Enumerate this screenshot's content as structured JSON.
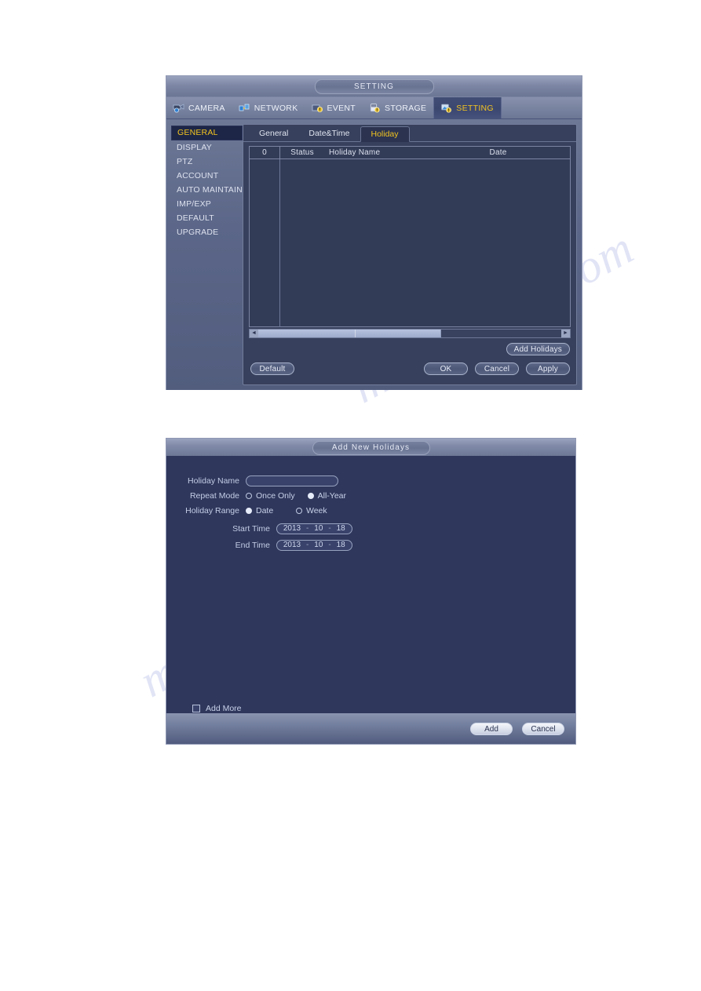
{
  "watermark": {
    "line1": "manualslib.com",
    "line2": "manualslib.com"
  },
  "setting_window": {
    "title": "SETTING",
    "menu": [
      {
        "label": "CAMERA",
        "icon": "camera-icon",
        "active": false
      },
      {
        "label": "NETWORK",
        "icon": "network-icon",
        "active": false
      },
      {
        "label": "EVENT",
        "icon": "event-icon",
        "active": false
      },
      {
        "label": "STORAGE",
        "icon": "storage-icon",
        "active": false
      },
      {
        "label": "SETTING",
        "icon": "setting-icon",
        "active": true
      }
    ],
    "sidebar": [
      {
        "label": "GENERAL",
        "active": true
      },
      {
        "label": "DISPLAY",
        "active": false
      },
      {
        "label": "PTZ",
        "active": false
      },
      {
        "label": "ACCOUNT",
        "active": false
      },
      {
        "label": "AUTO MAINTAIN",
        "active": false
      },
      {
        "label": "IMP/EXP",
        "active": false
      },
      {
        "label": "DEFAULT",
        "active": false
      },
      {
        "label": "UPGRADE",
        "active": false
      }
    ],
    "tabs": [
      {
        "label": "General",
        "active": false
      },
      {
        "label": "Date&Time",
        "active": false
      },
      {
        "label": "Holiday",
        "active": true
      }
    ],
    "table": {
      "columns": [
        "0",
        "Status",
        "Holiday Name",
        "Date"
      ],
      "rows": []
    },
    "scrollbar": {
      "left_arrow": "◄",
      "right_arrow": "►",
      "thumb_percent": 60
    },
    "buttons": {
      "add_holidays": "Add Holidays",
      "default": "Default",
      "ok": "OK",
      "cancel": "Cancel",
      "apply": "Apply"
    }
  },
  "add_holiday_window": {
    "title": "Add New Holidays",
    "fields": {
      "holiday_name_label": "Holiday Name",
      "holiday_name_value": "",
      "repeat_mode_label": "Repeat Mode",
      "repeat_once_label": "Once Only",
      "repeat_once_selected": false,
      "repeat_allyear_label": "All-Year",
      "repeat_allyear_selected": true,
      "holiday_range_label": "Holiday Range",
      "range_date_label": "Date",
      "range_date_selected": true,
      "range_week_label": "Week",
      "range_week_selected": false,
      "start_time_label": "Start Time",
      "start_year": "2013",
      "start_month": "10",
      "start_day": "18",
      "end_time_label": "End Time",
      "end_year": "2013",
      "end_month": "10",
      "end_day": "18",
      "add_more_label": "Add More",
      "add_more_checked": false
    },
    "buttons": {
      "add": "Add",
      "cancel": "Cancel"
    }
  }
}
